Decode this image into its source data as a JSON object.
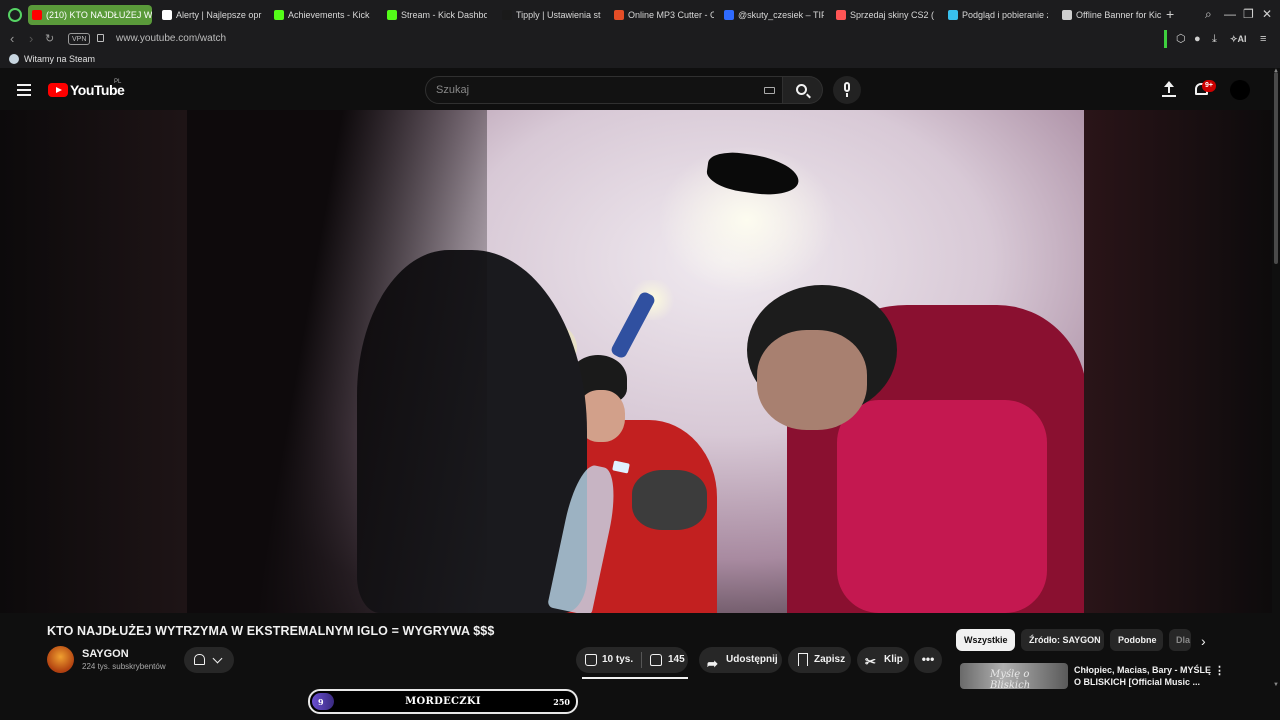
{
  "browser": {
    "tabs": [
      {
        "label": "(210) KTO NAJDŁUŻEJ W",
        "active": true,
        "favicon_color": "#ff0000"
      },
      {
        "label": "Alerty | Najlepsze opr",
        "active": false,
        "favicon_color": "#ffffff"
      },
      {
        "label": "Achievements - Kick",
        "active": false,
        "favicon_color": "#53fc18"
      },
      {
        "label": "Stream - Kick Dashbo",
        "active": false,
        "favicon_color": "#53fc18"
      },
      {
        "label": "Tipply | Ustawienia st",
        "active": false,
        "favicon_color": "#1a1a1a"
      },
      {
        "label": "Online MP3 Cutter - C",
        "active": false,
        "favicon_color": "#e44d26"
      },
      {
        "label": "@skuty_czesiek – TIP",
        "active": false,
        "favicon_color": "#2f6bff"
      },
      {
        "label": "Sprzedaj skiny CS2 (",
        "active": false,
        "favicon_color": "#ff5555"
      },
      {
        "label": "Podgląd i pobieranie z",
        "active": false,
        "favicon_color": "#39c0ed"
      },
      {
        "label": "Offline Banner for Kic",
        "active": false,
        "favicon_color": "#cfcfcf"
      }
    ],
    "new_tab_glyph": "+",
    "window_controls": {
      "search": "⌕",
      "minimize": "—",
      "restore": "❐",
      "close": "✕"
    },
    "address": {
      "vpn_label": "VPN",
      "url": "www.youtube.com/watch",
      "ai_label": "AI"
    },
    "bookmark": {
      "label": "Witamy na Steam"
    }
  },
  "youtube": {
    "logo_text": "YouTube",
    "country_code": "PL",
    "search_placeholder": "Szukaj",
    "notification_count": "9+",
    "video": {
      "title": "KTO NAJDŁUŻEJ WYTRZYMA W EKSTREMALNYM IGLO = WYGRYWA $$$",
      "channel": "SAYGON",
      "subscribers": "224 tys. subskrybentów",
      "likes": "10 tys.",
      "dislikes": "145",
      "share_label": "Udostępnij",
      "save_label": "Zapisz",
      "clip_label": "Klip",
      "more_glyph": "•••"
    },
    "chips": [
      {
        "label": "Wszystkie",
        "active": true
      },
      {
        "label": "Źródło: SAYGON",
        "active": false
      },
      {
        "label": "Podobne",
        "active": false
      },
      {
        "label": "Dla",
        "active": false
      }
    ],
    "recommendation": {
      "title": "Chłopiec, Macias, Bary - MYŚLĘ O BLISKICH [Official Music ...",
      "thumb_text": "Myślę o Bliskich"
    }
  },
  "overlay": {
    "start_value": "9",
    "label": "MORDECZKI",
    "end_value": "250",
    "progress": 0.036
  }
}
